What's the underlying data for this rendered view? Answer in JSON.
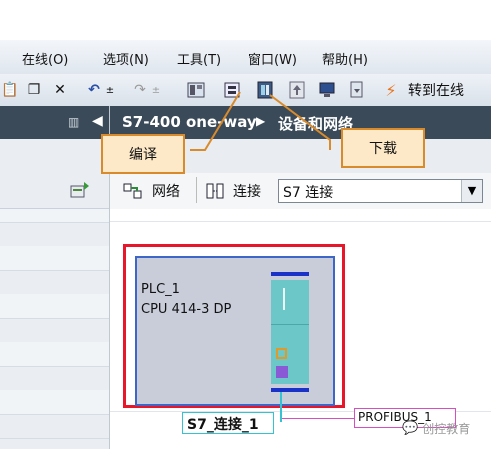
{
  "menu": [
    "在线(O)",
    "选项(N)",
    "工具(T)",
    "窗口(W)",
    "帮助(H)"
  ],
  "toolbar": {
    "go_online": "转到在线"
  },
  "editor": {
    "title": "S7-400 one-way",
    "subtitle": "设备和网络"
  },
  "view": {
    "network": "网络",
    "connections": "连接",
    "connection_type": "S7 连接"
  },
  "device": {
    "name": "PLC_1",
    "cpu": "CPU 414-3 DP"
  },
  "connection_label": "S7_连接_1",
  "profibus_label": "PROFIBUS_1",
  "callouts": {
    "compile": "编译",
    "download": "下载"
  },
  "watermark": "创控教育",
  "colors": {
    "highlight": "#e8162b",
    "callout_border": "#d98b2b",
    "connection": "#35c3d4",
    "profibus": "#d44fbf"
  }
}
